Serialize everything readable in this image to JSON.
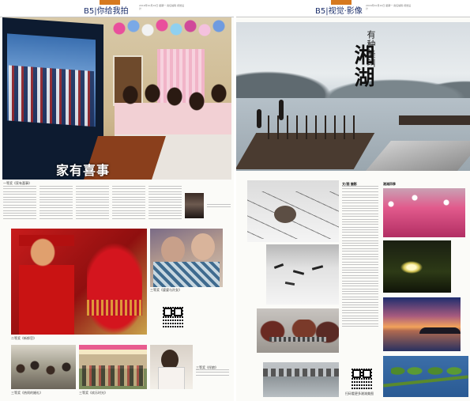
{
  "left_page": {
    "header": {
      "page_number": "B5",
      "section": "你给我拍",
      "meta": "2016年10月10日 星期一 责任编辑 视觉设计"
    },
    "headline": "家有喜事",
    "text_columns": 6,
    "captions": [
      "一等奖《家有喜事》",
      "二等奖《新郎官》",
      "三等奖《婆婆与孙女》",
      "三等奖《热闹的婚礼》",
      "三等奖《欢乐时光》",
      "三等奖《伴娘》"
    ]
  },
  "right_page": {
    "header": {
      "page_number": "B5",
      "section": "视觉·影像",
      "meta": "2016年10月10日 星期一 责任编辑 视觉设计"
    },
    "title_line_1": "有种美叫",
    "title_line_2": "湘湖",
    "author_label": "文/图 摄影",
    "text_columns": 3,
    "captions": [
      "湘湖四季",
      "扫码看更多湘湖美图"
    ]
  }
}
